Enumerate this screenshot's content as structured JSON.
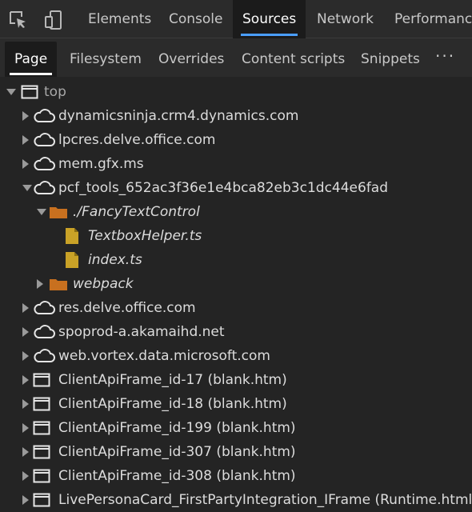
{
  "toolbar": {
    "inspect_icon": "inspect-element-icon",
    "device_icon": "device-emulation-icon",
    "tabs": [
      "Elements",
      "Console",
      "Sources",
      "Network",
      "Performance"
    ],
    "active_tab": "Sources"
  },
  "subtabs": {
    "items": [
      "Page",
      "Filesystem",
      "Overrides",
      "Content scripts",
      "Snippets"
    ],
    "active": "Page",
    "more_label": "···"
  },
  "tree": [
    {
      "label": "top",
      "kind": "frame",
      "expanded": true,
      "level": 0
    },
    {
      "label": "dynamicsninja.crm4.dynamics.com",
      "kind": "cloud",
      "expanded": false,
      "level": 1
    },
    {
      "label": "lpcres.delve.office.com",
      "kind": "cloud",
      "expanded": false,
      "level": 1
    },
    {
      "label": "mem.gfx.ms",
      "kind": "cloud",
      "expanded": false,
      "level": 1
    },
    {
      "label": "pcf_tools_652ac3f36e1e4bca82eb3c1dc44e6fad",
      "kind": "cloud",
      "expanded": true,
      "level": 1
    },
    {
      "label": "./FancyTextControl",
      "kind": "folder",
      "expanded": true,
      "level": 2
    },
    {
      "label": "TextboxHelper.ts",
      "kind": "file",
      "level": 3
    },
    {
      "label": "index.ts",
      "kind": "file",
      "level": 3
    },
    {
      "label": "webpack",
      "kind": "folder",
      "expanded": false,
      "level": 2
    },
    {
      "label": "res.delve.office.com",
      "kind": "cloud",
      "expanded": false,
      "level": 1
    },
    {
      "label": "spoprod-a.akamaihd.net",
      "kind": "cloud",
      "expanded": false,
      "level": 1
    },
    {
      "label": "web.vortex.data.microsoft.com",
      "kind": "cloud",
      "expanded": false,
      "level": 1
    },
    {
      "label": "ClientApiFrame_id-17 (blank.htm)",
      "kind": "frame",
      "expanded": false,
      "level": 1
    },
    {
      "label": "ClientApiFrame_id-18 (blank.htm)",
      "kind": "frame",
      "expanded": false,
      "level": 1
    },
    {
      "label": "ClientApiFrame_id-199 (blank.htm)",
      "kind": "frame",
      "expanded": false,
      "level": 1
    },
    {
      "label": "ClientApiFrame_id-307 (blank.htm)",
      "kind": "frame",
      "expanded": false,
      "level": 1
    },
    {
      "label": "ClientApiFrame_id-308 (blank.htm)",
      "kind": "frame",
      "expanded": false,
      "level": 1
    },
    {
      "label": "LivePersonaCard_FirstPartyIntegration_IFrame (Runtime.html)",
      "kind": "frame",
      "expanded": false,
      "level": 1
    }
  ],
  "colors": {
    "accent": "#4a9eff",
    "folder": "#c8701f",
    "file": "#c9a227",
    "icon_outline": "#e6e6e6"
  }
}
